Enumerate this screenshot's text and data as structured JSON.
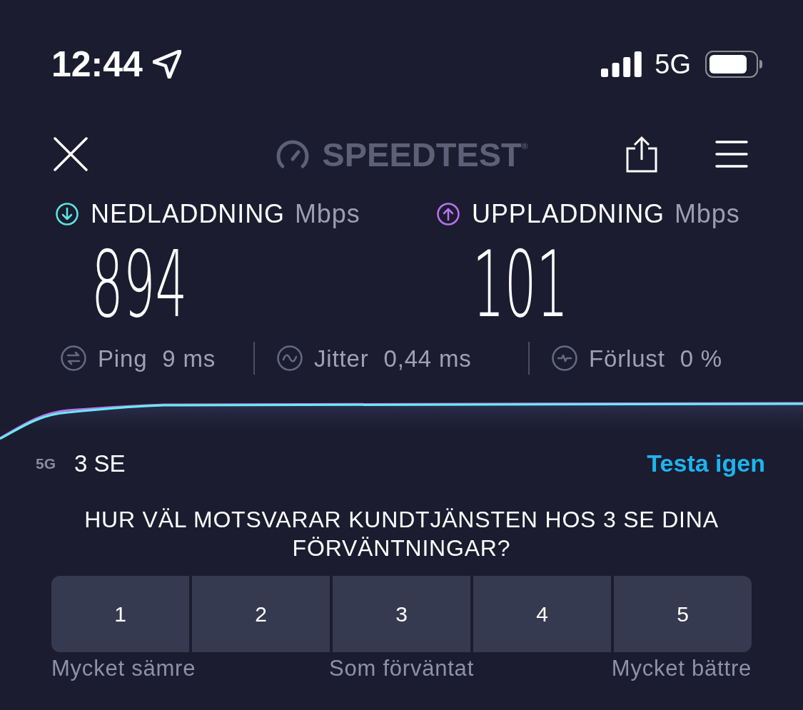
{
  "status_bar": {
    "time": "12:44",
    "network": "5G"
  },
  "header": {
    "logo": "SPEEDTEST$^{®}$"
  },
  "results": [
    {
      "kind": "download",
      "label": "NEDLADDNING",
      "unit": "Mbps",
      "value": "894"
    },
    {
      "kind": "upload",
      "label": "UPPLADDNING",
      "unit": "Mbps",
      "value": "101"
    }
  ],
  "stats": [
    {
      "kind": "ping",
      "label": "Ping",
      "value": "9 ms"
    },
    {
      "kind": "jitter",
      "label": "Jitter",
      "value": "0,44 ms"
    },
    {
      "kind": "loss",
      "label": "Förlust",
      "value": "0 %"
    }
  ],
  "connection": {
    "type": "5G",
    "provider": "3 SE",
    "action": "Testa igen"
  },
  "survey": {
    "question": "HUR VÄL MOTSVARAR KUNDTJÄNSTEN HOS 3 SE DINA FÖRVÄNTNINGAR?",
    "options": [
      {
        "label": "1",
        "selected": false
      },
      {
        "label": "2",
        "selected": false
      },
      {
        "label": "3",
        "selected": false
      },
      {
        "label": "4",
        "selected": false
      },
      {
        "label": "5",
        "selected": false
      }
    ],
    "scale_labels": [
      "Mycket sämre",
      "Som förväntat",
      "Mycket bättre"
    ]
  }
}
